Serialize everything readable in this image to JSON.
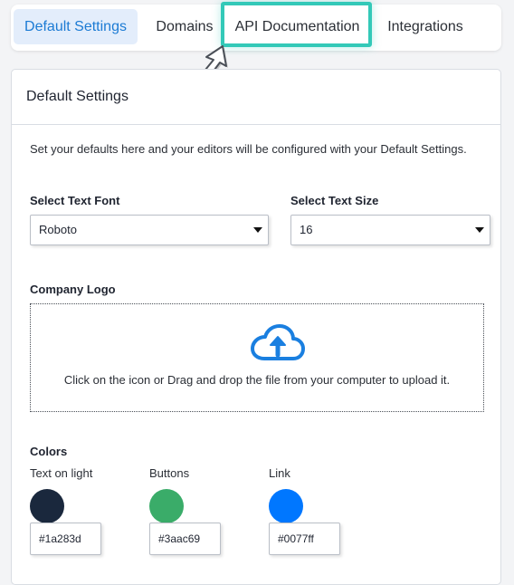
{
  "tabs": [
    {
      "label": "Default Settings",
      "active": true
    },
    {
      "label": "Domains",
      "active": false
    },
    {
      "label": "API Documentation",
      "active": false,
      "highlighted": true
    },
    {
      "label": "Integrations",
      "active": false
    }
  ],
  "panel": {
    "title": "Default Settings",
    "description": "Set your defaults here and your editors will be configured with your Default Settings.",
    "font_field": {
      "label": "Select Text Font",
      "value": "Roboto"
    },
    "size_field": {
      "label": "Select Text Size",
      "value": "16"
    },
    "logo": {
      "label": "Company Logo",
      "icon": "cloud-upload-icon",
      "instruction": "Click on the icon or Drag and drop the file from your computer to upload it."
    },
    "colors": {
      "label": "Colors",
      "items": [
        {
          "label": "Text on light",
          "value": "#1a283d"
        },
        {
          "label": "Buttons",
          "value": "#3aac69"
        },
        {
          "label": "Link",
          "value": "#0077ff"
        }
      ]
    }
  },
  "theme": {
    "active_tab_bg": "#e3edfb",
    "active_tab_text": "#1c7bd4",
    "highlight": "#33c9b8",
    "upload_icon": "#1a7fe0"
  }
}
